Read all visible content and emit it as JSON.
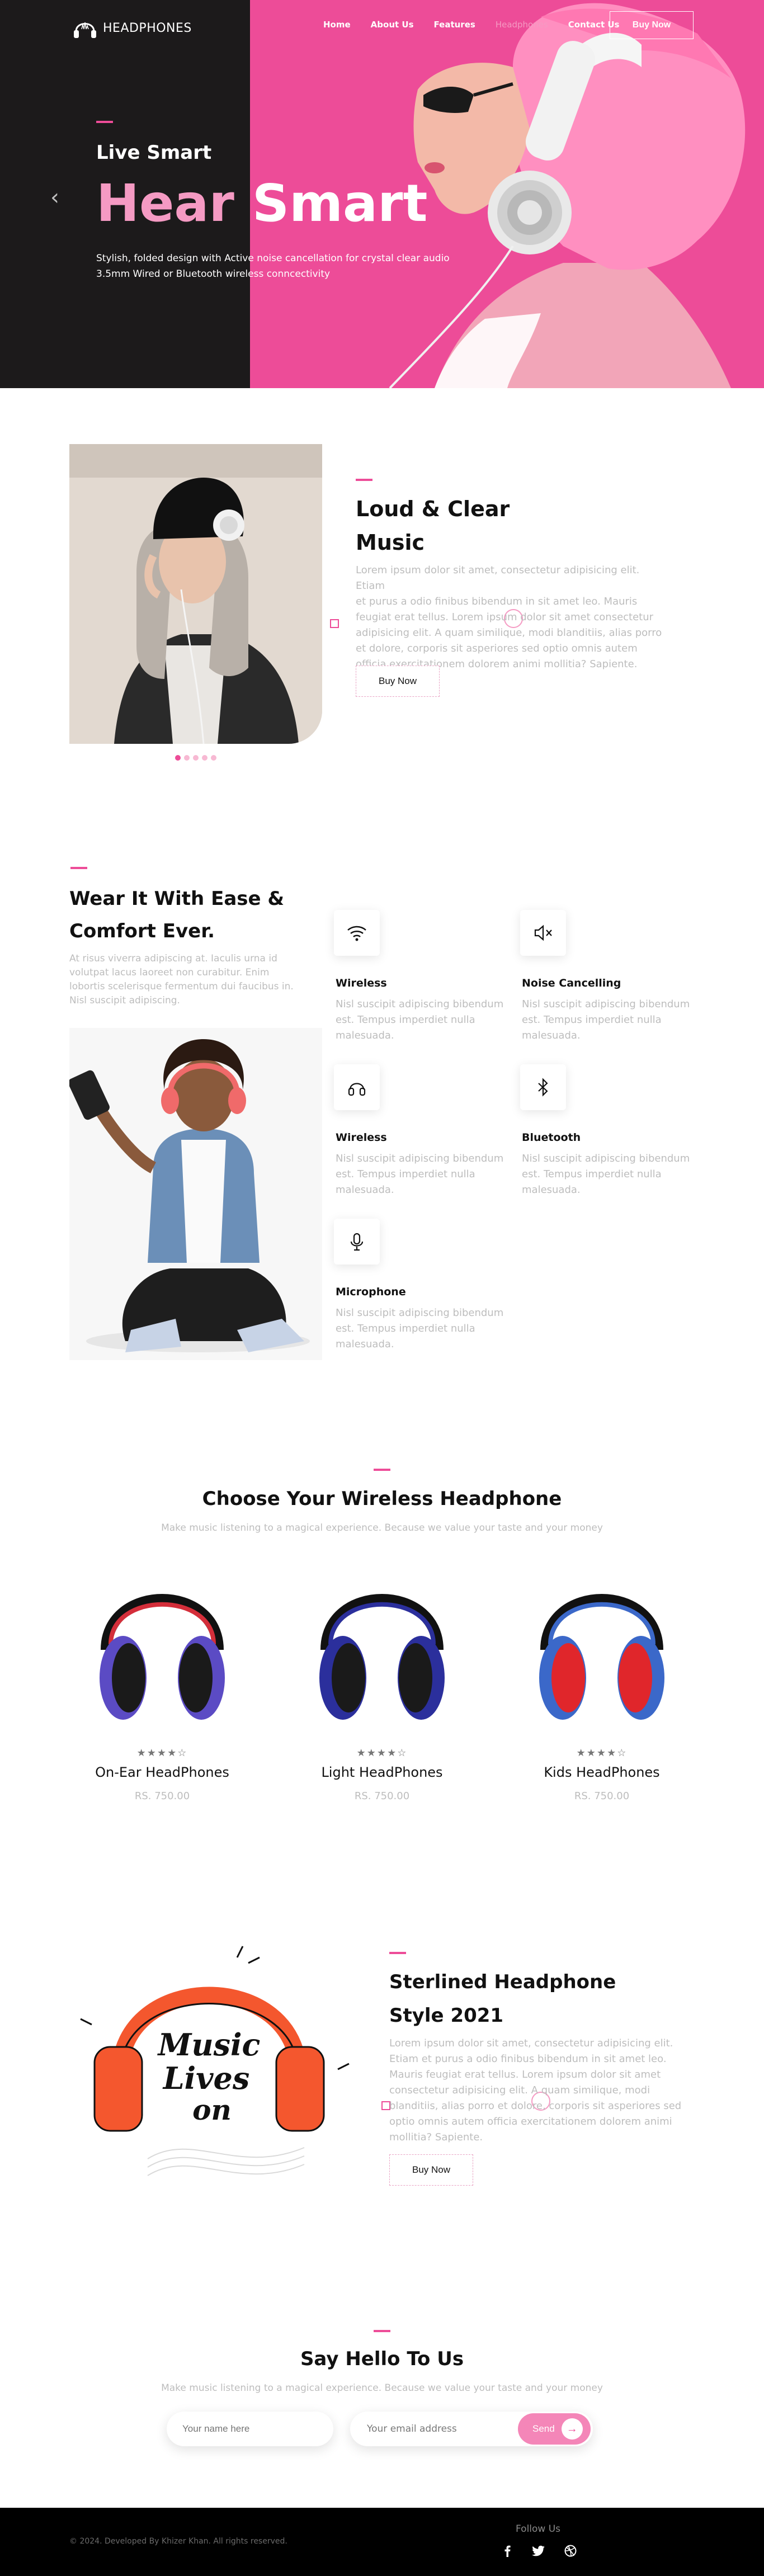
{
  "brand": {
    "name": "HEADPHONES"
  },
  "nav": {
    "items": [
      "Home",
      "About Us",
      "Features",
      "Headphones",
      "Contact Us"
    ],
    "active": "Headphones",
    "cta": "Buy Now"
  },
  "hero": {
    "subtitle": "Live Smart",
    "title_a": "Hear",
    "title_b": "Smart",
    "desc_1": "Stylish, folded design with Active noise cancellation for crystal clear audio",
    "desc_2": "3.5mm Wired or Bluetooth wireless conncectivity",
    "prev_arrow": "‹"
  },
  "about": {
    "title_1": "Loud & Clear",
    "title_2": "Music",
    "lines": [
      "Lorem ipsum dolor sit amet, consectetur adipisicing elit. Etiam",
      "et purus a odio finibus bibendum in sit amet leo. Mauris",
      "feugiat erat tellus. Lorem ipsum dolor sit amet consectetur",
      "adipisicing elit. A quam similique, modi blanditiis, alias porro",
      "et dolore, corporis sit asperiores sed optio omnis autem",
      "officia exercitationem dolorem animi mollitia? Sapiente."
    ],
    "button": "Buy Now"
  },
  "features": {
    "title_1": "Wear It With Ease &",
    "title_2": "Comfort Ever.",
    "lines": [
      "At risus viverra adipiscing at. Iaculis urna id",
      "volutpat lacus laoreet non curabitur. Enim",
      "lobortis scelerisque fermentum dui faucibus in.",
      "Nisl suscipit adipiscing."
    ],
    "items": [
      {
        "title": "Wireless",
        "icon": "wifi-icon",
        "desc": [
          "Nisl suscipit adipiscing bibendum",
          "est. Tempus imperdiet nulla",
          "malesuada."
        ]
      },
      {
        "title": "Noise Cancelling",
        "icon": "speaker-mute-icon",
        "desc": [
          "Nisl suscipit adipiscing bibendum",
          "est. Tempus imperdiet nulla",
          "malesuada."
        ]
      },
      {
        "title": "Wireless",
        "icon": "headphones-icon",
        "desc": [
          "Nisl suscipit adipiscing bibendum",
          "est. Tempus imperdiet nulla",
          "malesuada."
        ]
      },
      {
        "title": "Bluetooth",
        "icon": "bluetooth-icon",
        "desc": [
          "Nisl suscipit adipiscing bibendum",
          "est. Tempus imperdiet nulla",
          "malesuada."
        ]
      },
      {
        "title": "Microphone",
        "icon": "microphone-icon",
        "desc": [
          "Nisl suscipit adipiscing bibendum",
          "est. Tempus imperdiet nulla",
          "malesuada."
        ]
      }
    ]
  },
  "products": {
    "title": "Choose Your Wireless Headphone",
    "subtitle": "Make music listening to a magical experience. Because we value your taste and your money",
    "items": [
      {
        "name": "On-Ear HeadPhones",
        "price": "RS. 750.00",
        "stars": "★★★★☆",
        "colors": [
          "#d42e3a",
          "#5b4bc4"
        ]
      },
      {
        "name": "Light HeadPhones",
        "price": "RS. 750.00",
        "stars": "★★★★☆",
        "colors": [
          "#2b2f9c",
          "#2b2f9c"
        ]
      },
      {
        "name": "Kids HeadPhones",
        "price": "RS. 750.00",
        "stars": "★★★★☆",
        "colors": [
          "#3b68c9",
          "#e0262b"
        ]
      }
    ]
  },
  "promo": {
    "title_1": "Sterlined Headphone",
    "title_2": "Style 2021",
    "art_text_1": "Music",
    "art_text_2": "Lives",
    "art_text_3": "on",
    "lines": [
      "Lorem ipsum dolor sit amet, consectetur adipisicing elit.",
      "Etiam et purus a odio finibus bibendum in sit amet leo.",
      "Mauris feugiat erat tellus. Lorem ipsum dolor sit amet",
      "consectetur adipisicing elit. A quam similique, modi",
      "blanditiis, alias porro et dolore, corporis sit asperiores sed",
      "optio omnis autem officia exercitationem dolorem animi",
      "mollitia? Sapiente."
    ],
    "button": "Buy Now"
  },
  "contact": {
    "title": "Say Hello To Us",
    "subtitle": "Make music listening to a magical experience. Because we value your taste and your money",
    "name_placeholder": "Your name here",
    "email_placeholder": "Your email address",
    "send": "Send",
    "send_arrow": "→"
  },
  "footer": {
    "copyright": "© 2024. Developed By Khizer Khan. All rights reserved.",
    "follow": "Follow Us",
    "socials": [
      "facebook-icon",
      "twitter-icon",
      "dribbble-icon"
    ]
  },
  "colors": {
    "accent": "#ed4c98",
    "accent_light": "#f59ac3",
    "dark": "#1c1a1b",
    "muted": "#bdbdbd"
  }
}
